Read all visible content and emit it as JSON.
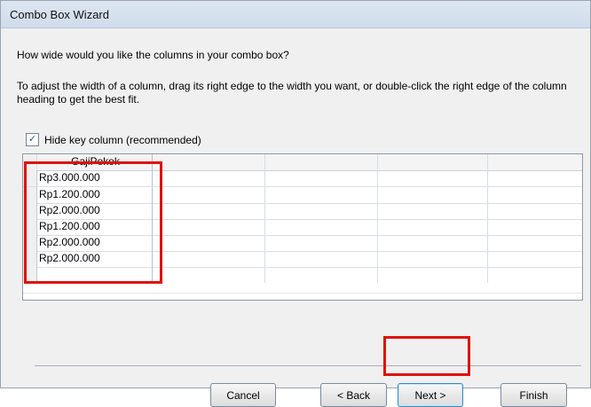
{
  "window": {
    "title": "Combo Box Wizard"
  },
  "wizard": {
    "question": "How wide would you like the columns in your combo box?",
    "instructions": "To adjust the width of a column, drag its right edge to the width you want, or double-click the right edge of the column heading to get the best fit.",
    "hide_key_label": "Hide key column (recommended)",
    "hide_key_checked": true
  },
  "grid": {
    "header": [
      "GajiPokok"
    ],
    "rows": [
      "Rp3.000.000",
      "Rp1.200.000",
      "Rp2.000.000",
      "Rp1.200.000",
      "Rp2.000.000",
      "Rp2.000.000"
    ]
  },
  "buttons": {
    "cancel": "Cancel",
    "back": "< Back",
    "next": "Next >",
    "finish": "Finish"
  },
  "highlight_color": "#e01010"
}
